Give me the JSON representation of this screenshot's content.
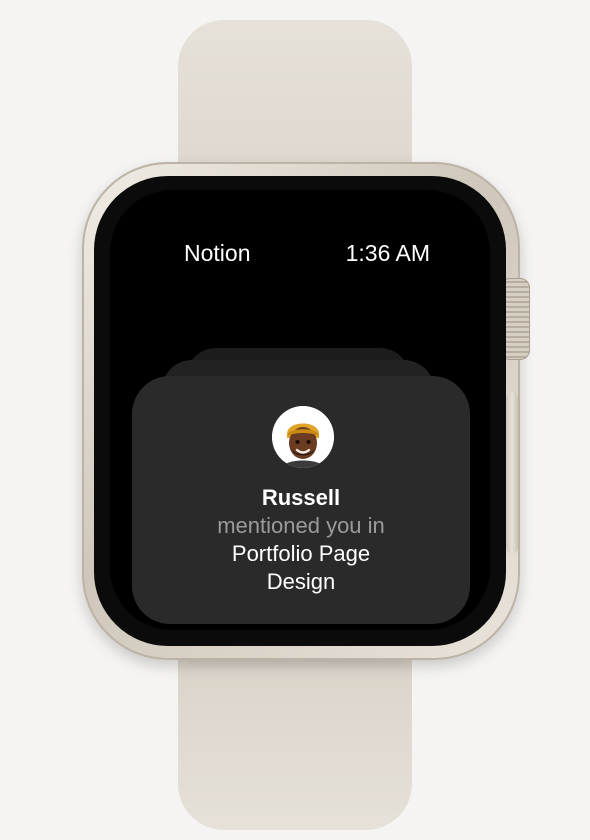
{
  "watch": {
    "app_name": "Notion",
    "time": "1:36 AM"
  },
  "notification": {
    "sender": "Russell",
    "action": "mentioned you in",
    "document": "Portfolio Page Design"
  },
  "colors": {
    "background": "#f5f4f2",
    "band": "#e3ddd4",
    "screen": "#000000",
    "card": "#2a2a2a",
    "secondary_text": "#9b9b9b"
  },
  "icons": {
    "avatar": "memoji-avatar"
  }
}
